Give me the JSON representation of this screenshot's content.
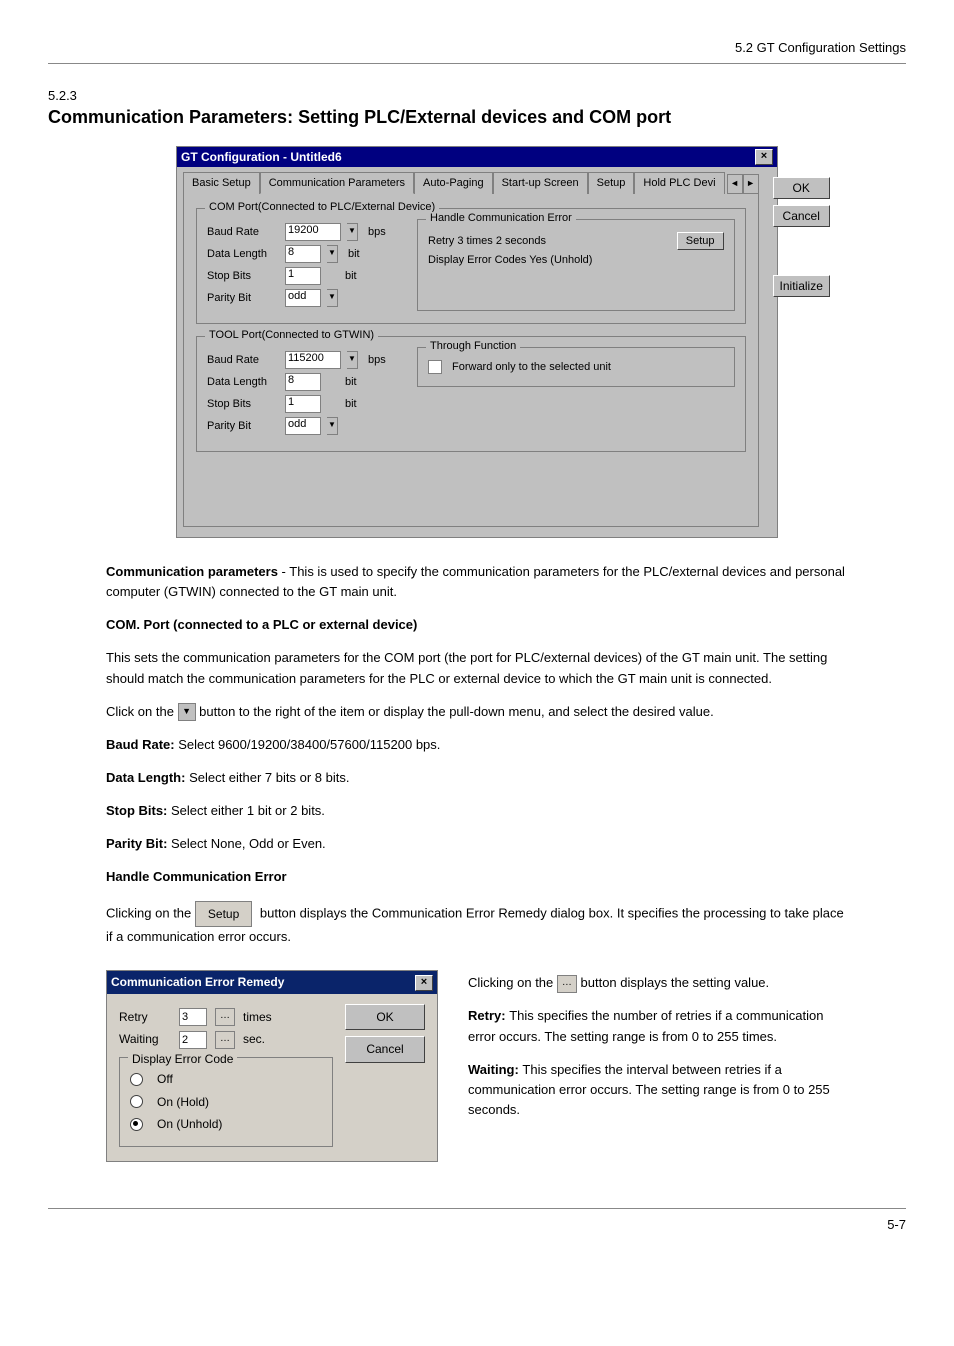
{
  "doc": {
    "section_ref": "5.2 GT Configuration Settings",
    "section_num": "5.2.3",
    "section_title": "Communication Parameters: Setting PLC/External devices and COM port",
    "intro_lead": "Communication parameters",
    "intro_text": "This is used to specify the communication parameters for the PLC/external devices and personal computer (GTWIN) connected to the GT main unit.",
    "page": "5-7"
  },
  "config_dialog": {
    "title": "GT Configuration - Untitled6",
    "tabs": [
      "Basic Setup",
      "Communication Parameters",
      "Auto-Paging",
      "Start-up Screen",
      "Setup",
      "Hold PLC Devi"
    ],
    "side_buttons": {
      "ok": "OK",
      "cancel": "Cancel",
      "initialize": "Initialize"
    },
    "com_port": {
      "legend": "COM Port(Connected to PLC/External Device)",
      "baud_label": "Baud Rate",
      "baud_value": "19200",
      "baud_unit": "bps",
      "data_label": "Data Length",
      "data_value": "8",
      "data_unit": "bit",
      "stop_label": "Stop Bits",
      "stop_value": "1",
      "stop_unit": "bit",
      "parity_label": "Parity Bit",
      "parity_value": "odd",
      "handle_legend": "Handle Communication Error",
      "retry_line": "Retry  3 times   2 seconds",
      "setup_btn": "Setup",
      "display_line": "Display Error Codes  Yes (Unhold)"
    },
    "tool_port": {
      "legend": "TOOL Port(Connected to GTWIN)",
      "baud_label": "Baud Rate",
      "baud_value": "115200",
      "baud_unit": "bps",
      "data_label": "Data Length",
      "data_value": "8",
      "data_unit": "bit",
      "stop_label": "Stop Bits",
      "stop_value": "1",
      "stop_unit": "bit",
      "parity_label": "Parity Bit",
      "parity_value": "odd",
      "through_legend": "Through Function",
      "through_check": "Forward only to the selected unit"
    }
  },
  "explain": {
    "com_head": "COM. Port (connected to a PLC or external device)",
    "com_p1": "This sets the communication parameters for the COM port (the port for PLC/external devices) of the GT main unit. The setting should match the communication parameters for the PLC or external device to which the GT main unit is connected.",
    "com_p2_a": "Click on the ",
    "com_p2_b": " button to the right of the item or display the pull-down menu, and select the desired value.",
    "baud": "Baud Rate: Select 9600/19200/38400/57600/115200 bps.",
    "datalen": "Data Length: Select either 7 bits or 8 bits.",
    "stop": "Stop Bits: Select either 1 bit or 2 bits.",
    "parity": "Parity Bit: Select None, Odd or Even.",
    "handle_head": "Handle Communication Error",
    "handle_p1_a": "Clicking on the ",
    "handle_p1_b": " button displays the Communication Error Remedy dialog box. It specifies the processing to take place if a communication error occurs.",
    "dlg2_side_a": "Clicking on the ",
    "dlg2_side_b": " button displays the setting value.",
    "retry_detail": "Retry: This specifies the number of retries if a communication error occurs. The setting range is from 0 to 255 times.",
    "waiting_detail": "Waiting: This specifies the interval between retries if a communication error occurs. The setting range is from 0 to 255 seconds."
  },
  "error_dialog": {
    "title": "Communication Error Remedy",
    "retry_label": "Retry",
    "retry_value": "3",
    "retry_unit": "times",
    "waiting_label": "Waiting",
    "waiting_value": "2",
    "waiting_unit": "sec.",
    "display_legend": "Display Error Code",
    "opt_off": "Off",
    "opt_hold": "On (Hold)",
    "opt_unhold": "On (Unhold)",
    "ok": "OK",
    "cancel": "Cancel"
  }
}
